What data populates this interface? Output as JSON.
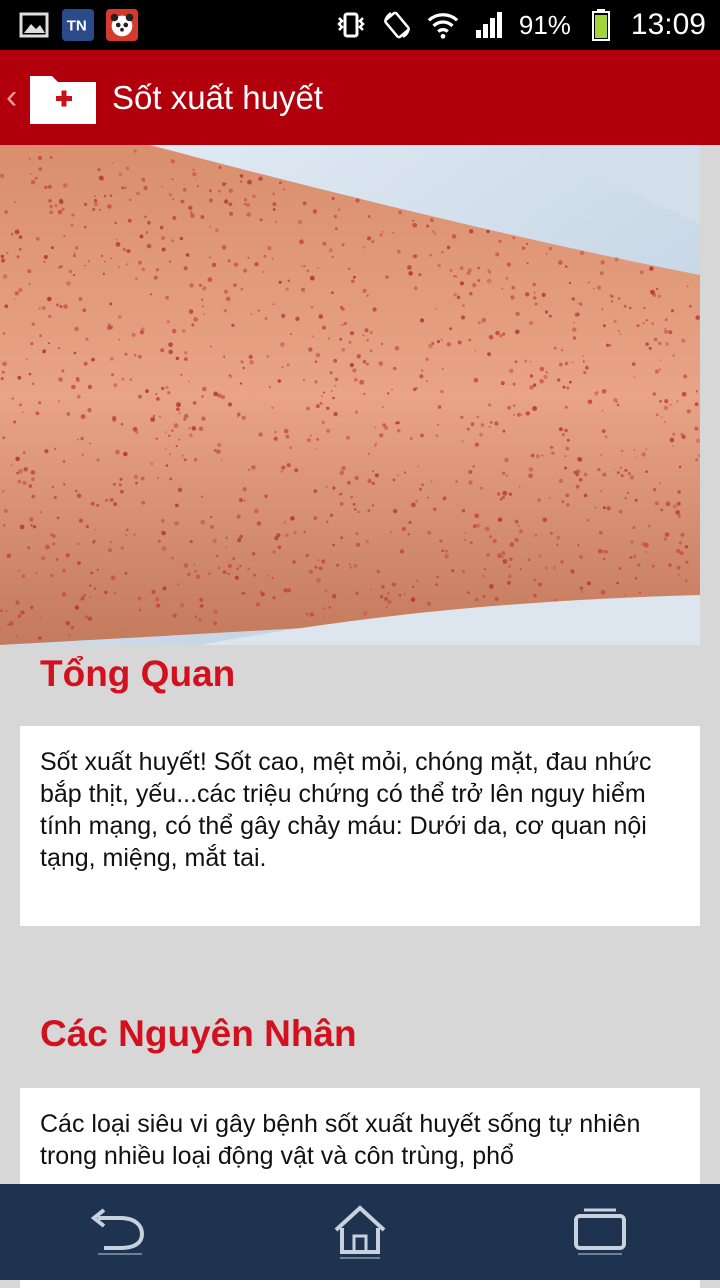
{
  "status_bar": {
    "battery": "91%",
    "time": "13:09",
    "icons": [
      "gallery-icon",
      "tn-app-icon",
      "panda-app-icon",
      "vibrate-icon",
      "rotate-icon",
      "wifi-icon",
      "signal-icon",
      "battery-icon"
    ]
  },
  "header": {
    "title": "Sốt xuất huyết",
    "icon": "medical-folder-icon"
  },
  "sections": [
    {
      "heading": "Tổng Quan",
      "body": "Sốt xuất huyết! Sốt cao, mệt mỏi, chóng mặt, đau nhức bắp thịt, yếu...các triệu chứng có thể trở lên nguy hiểm tính mạng, có thể gây chảy máu: Dưới da, cơ quan nội tạng, miệng, mắt tai."
    },
    {
      "heading": "Các Nguyên Nhân",
      "body": "Các loại siêu vi gây bệnh sốt xuất huyết sống tự nhiên trong nhiều loại động vật và côn trùng, phổ"
    }
  ],
  "bottom_nav": [
    "back-nav-icon",
    "home-nav-icon",
    "window-nav-icon"
  ],
  "colors": {
    "header_red": "#b1000c",
    "heading_red": "#d2101e",
    "nav_bg": "#1e3350",
    "page_bg": "#d7d7d7"
  }
}
